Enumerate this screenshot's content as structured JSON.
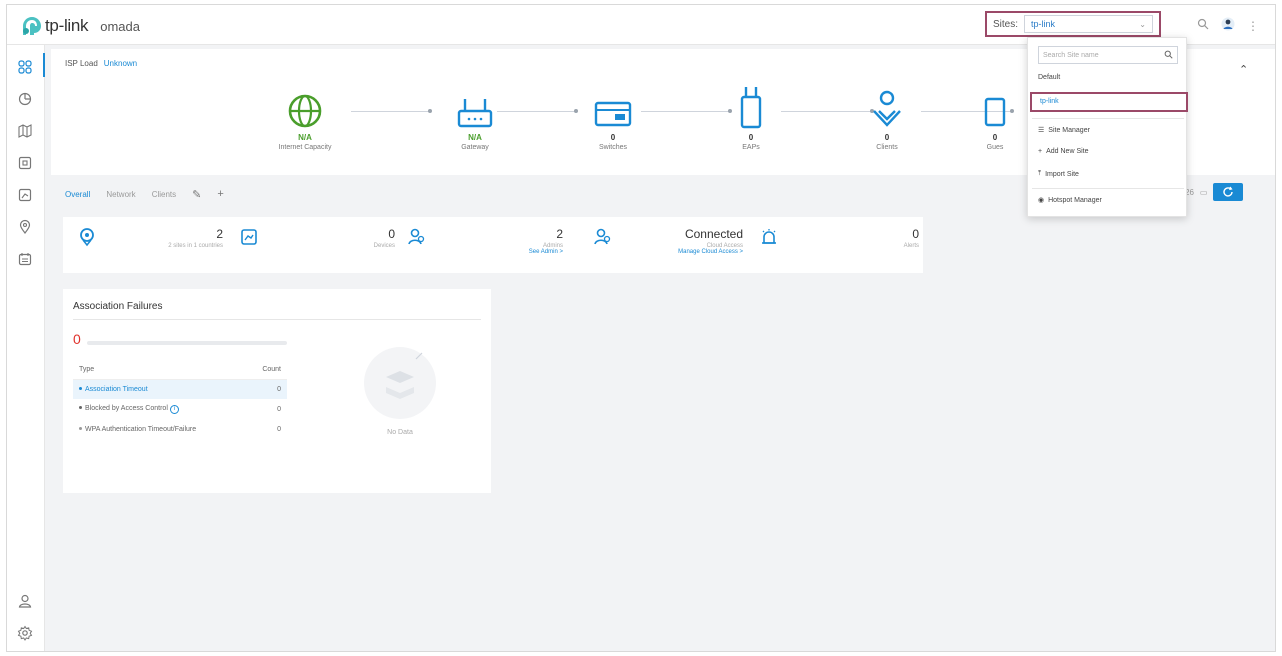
{
  "app": {
    "brand": "tp-link",
    "product": "omada"
  },
  "header": {
    "sites_label": "Sites:",
    "site_selected": "tp-link"
  },
  "site_dropdown": {
    "search_placeholder": "Search Site name",
    "sites": [
      "Default",
      "tp-link"
    ],
    "actions": [
      "Site Manager",
      "Add New Site",
      "Import Site",
      "Hotspot Manager"
    ]
  },
  "topology": {
    "isp_label": "ISP Load",
    "isp_value": "Unknown",
    "nodes": [
      {
        "value": "N/A",
        "label": "Internet Capacity"
      },
      {
        "value": "N/A",
        "label": "Gateway"
      },
      {
        "value": "0",
        "label": "Switches"
      },
      {
        "value": "0",
        "label": "EAPs"
      },
      {
        "value": "0",
        "label": "Clients"
      },
      {
        "value": "0",
        "label": "Gues"
      }
    ]
  },
  "tabs": [
    "Overall",
    "Network",
    "Clients"
  ],
  "toolbar": {
    "partial_text": "26"
  },
  "summary": {
    "sites": {
      "value": "2",
      "label": "2 sites in 1 countries"
    },
    "devices": {
      "value": "0",
      "label": "Devices"
    },
    "admins": {
      "value": "2",
      "label": "Admins",
      "link": "See Admin >"
    },
    "cloud": {
      "value": "Connected",
      "label": "Cloud Access",
      "link": "Manage Cloud Access >"
    },
    "alerts": {
      "value": "0",
      "label": "Alerts"
    }
  },
  "association_failures": {
    "title": "Association Failures",
    "total": "0",
    "columns": [
      "Type",
      "Count"
    ],
    "rows": [
      {
        "type": "Association Timeout",
        "count": "0"
      },
      {
        "type": "Blocked by Access Control",
        "count": "0"
      },
      {
        "type": "WPA Authentication Timeout/Failure",
        "count": "0"
      }
    ],
    "no_data": "No Data"
  },
  "colors": {
    "accent": "#1a8ad4",
    "highlight_border": "#9b4968",
    "positive": "#4a9e2b",
    "alert": "#e0312b"
  }
}
